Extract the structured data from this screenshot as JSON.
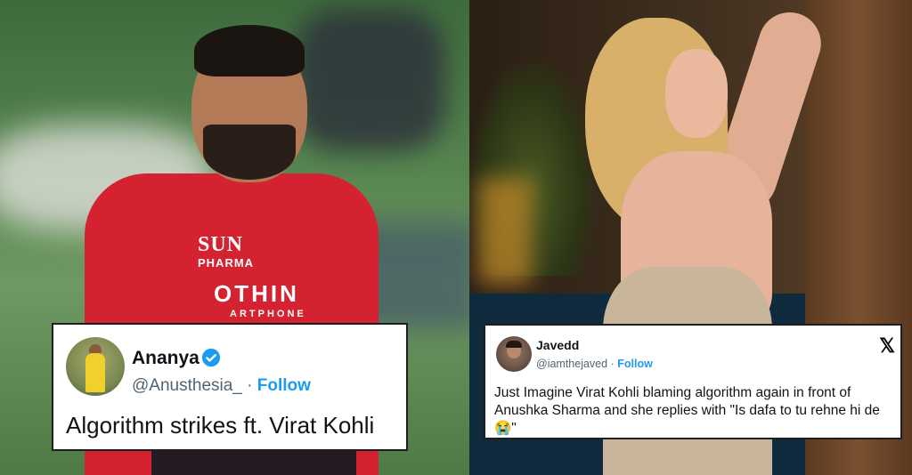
{
  "left_photo": {
    "jersey_sponsor_line1": "SUN",
    "jersey_sponsor_line2": "PHARMA",
    "jersey_sponsor_line3": "OTHIN",
    "jersey_sponsor_line4": "ARTPHONE",
    "colors": {
      "jersey": "#d42230",
      "field": "#56844f"
    }
  },
  "right_photo": {
    "colors": {
      "hair": "#d9b06a",
      "wall": "#6b4a2e",
      "pool": "#0f2a3c"
    }
  },
  "tweet_left": {
    "display_name": "Ananya",
    "handle": "@Anusthesia_",
    "separator": "·",
    "follow_label": "Follow",
    "text": "Algorithm strikes ft. Virat Kohli",
    "verified": true,
    "icons": {
      "avatar": "avatar-icon",
      "verified": "verified-badge-icon"
    }
  },
  "tweet_right": {
    "display_name": "Javedd",
    "handle": "@iamthejaved",
    "separator": "·",
    "follow_label": "Follow",
    "text": "Just Imagine Virat Kohli blaming algorithm again in front of Anushka Sharma and she replies with \"Is dafa to tu rehne hi de😭\"",
    "platform_logo": "𝕏",
    "icons": {
      "avatar": "avatar-icon",
      "platform": "x-logo-icon"
    }
  },
  "colors": {
    "link": "#1d9bf0",
    "secondary_text": "#536471",
    "primary_text": "#0f1419",
    "verified": "#1d9bf0"
  }
}
